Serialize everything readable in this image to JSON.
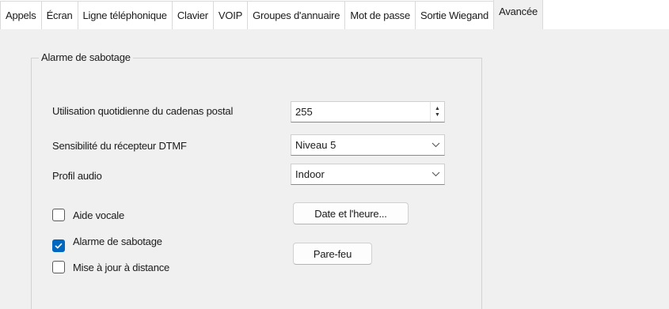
{
  "tabs": [
    "Appels",
    "Écran",
    "Ligne téléphonique",
    "Clavier",
    "VOIP",
    "Groupes d'annuaire",
    "Mot de passe",
    "Sortie Wiegand",
    "Avancée"
  ],
  "group_title": "Alarme de sabotage",
  "fields": {
    "postal_label": "Utilisation quotidienne du cadenas postal",
    "postal_value": "255",
    "dtmf_label": "Sensibilité du récepteur DTMF",
    "dtmf_value": "Niveau 5",
    "audio_label": "Profil audio",
    "audio_value": "Indoor"
  },
  "checkboxes": {
    "voice_aid": {
      "label": "Aide vocale",
      "checked": false
    },
    "tamper_alarm": {
      "label": "Alarme de sabotage",
      "checked": true
    },
    "remote_update": {
      "label": "Mise à jour à distance",
      "checked": false
    }
  },
  "buttons": {
    "datetime": "Date et l'heure...",
    "firewall": "Pare-feu"
  },
  "icons": {
    "spin_up": "spin-up-icon",
    "spin_down": "spin-down-icon",
    "dropdown": "chevron-down-icon",
    "check": "checkmark-icon"
  },
  "colors": {
    "accent": "#0067c0",
    "panel_bg": "#f0f0f0"
  }
}
